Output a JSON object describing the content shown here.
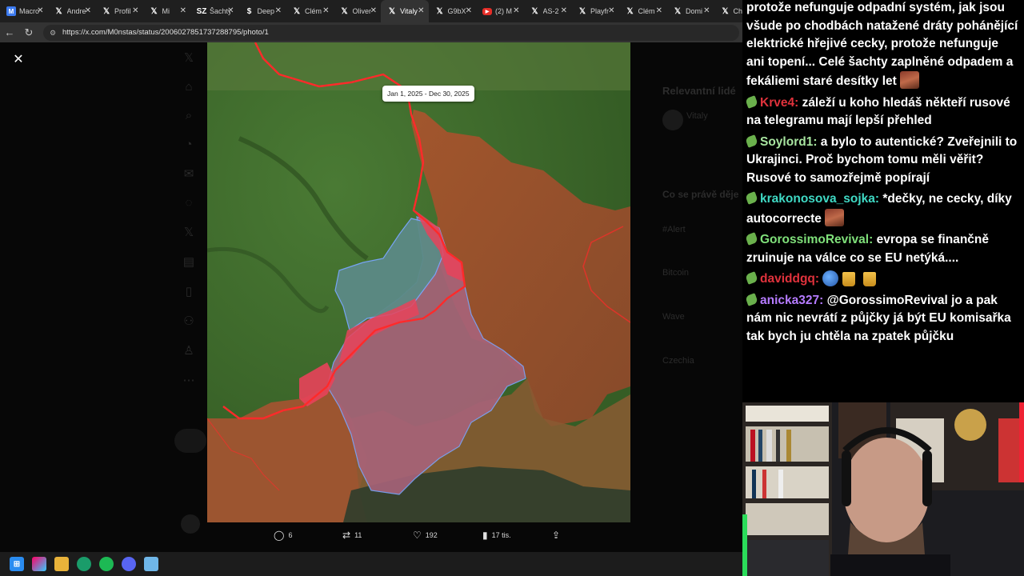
{
  "browser": {
    "tabs": [
      {
        "favicon": "M",
        "favicon_kind": "square",
        "title": "Macro"
      },
      {
        "favicon": "𝕏",
        "favicon_kind": "x",
        "title": "Andre"
      },
      {
        "favicon": "𝕏",
        "favicon_kind": "x",
        "title": "Profil"
      },
      {
        "favicon": "𝕏",
        "favicon_kind": "x",
        "title": "Mi"
      },
      {
        "favicon": "SZ",
        "favicon_kind": "text",
        "title": "Šachty"
      },
      {
        "favicon": "$",
        "favicon_kind": "text",
        "title": "Deep"
      },
      {
        "favicon": "𝕏",
        "favicon_kind": "x",
        "title": "Clém"
      },
      {
        "favicon": "𝕏",
        "favicon_kind": "x",
        "title": "Oliver"
      },
      {
        "favicon": "𝕏",
        "favicon_kind": "x",
        "title": "Vitaly",
        "active": true
      },
      {
        "favicon": "𝕏",
        "favicon_kind": "x",
        "title": "G9bX"
      },
      {
        "favicon": "▶",
        "favicon_kind": "youtube",
        "title": "(2) M"
      },
      {
        "favicon": "𝕏",
        "favicon_kind": "x",
        "title": "AS-2"
      },
      {
        "favicon": "𝕏",
        "favicon_kind": "x",
        "title": "Playfr"
      },
      {
        "favicon": "𝕏",
        "favicon_kind": "x",
        "title": "Clém"
      },
      {
        "favicon": "𝕏",
        "favicon_kind": "x",
        "title": "Domi"
      },
      {
        "favicon": "𝕏",
        "favicon_kind": "x",
        "title": "Ch"
      }
    ],
    "url": "https://x.com/M0nstas/status/2006027851737288795/photo/1"
  },
  "map": {
    "date_range": "Jan 1, 2025 - Dec 30, 2025",
    "colors": {
      "occupied": "#c0392b",
      "gained_2025": "#e8435a",
      "oblast_outline": "#7aa6ff",
      "field": "#3f6b2a"
    }
  },
  "post_actions": {
    "replies": "6",
    "reposts": "11",
    "likes": "192",
    "views": "17 tis."
  },
  "dim_sidebar": {
    "relevant_title": "Relevantní lidé",
    "user_name": "Vitaly",
    "trending_title": "Co se právě děje",
    "trends": [
      "#Alert",
      "Bitcoin",
      "Wave",
      "Czechia"
    ]
  },
  "chat": {
    "messages": [
      {
        "user": "",
        "color": "#ffffff",
        "text": "protože nefunguje odpadní systém, jak jsou všude po chodbách natažené dráty pohánějící elektrické hřejivé cecky, protože nefunguje ani topení... Celé šachty zaplněné odpadem a fekáliemi staré desítky let",
        "emote": "face",
        "first": true
      },
      {
        "user": "Krve4",
        "color": "#e0323c",
        "text": "záleží u koho hledáš někteří rusové na telegramu mají lepší přehled"
      },
      {
        "user": "Soylord1",
        "color": "#a8e5a0",
        "text": "a bylo to autentické? Zveřejnili to Ukrajinci. Proč bychom tomu měli věřit? Rusové to samozřejmě popírají"
      },
      {
        "user": "krakonosova_sojka",
        "color": "#3fd9c4",
        "text": "*dečky, ne cecky, díky autocorrecte",
        "emote": "face"
      },
      {
        "user": "GorossimoRevival",
        "color": "#7fe07a",
        "text": "evropa se finančně zruinuje na válce co se EU netýká...."
      },
      {
        "user": "daviddgq",
        "color": "#e0323c",
        "text": "",
        "emote": "pepe-beer"
      },
      {
        "user": "anicka327",
        "color": "#b57bff",
        "text": "@GorossimoRevival jo a pak nám nic nevrátí z půjčky já být EU komisařka tak bych ju chtěla na zpatek půjčku"
      }
    ]
  }
}
